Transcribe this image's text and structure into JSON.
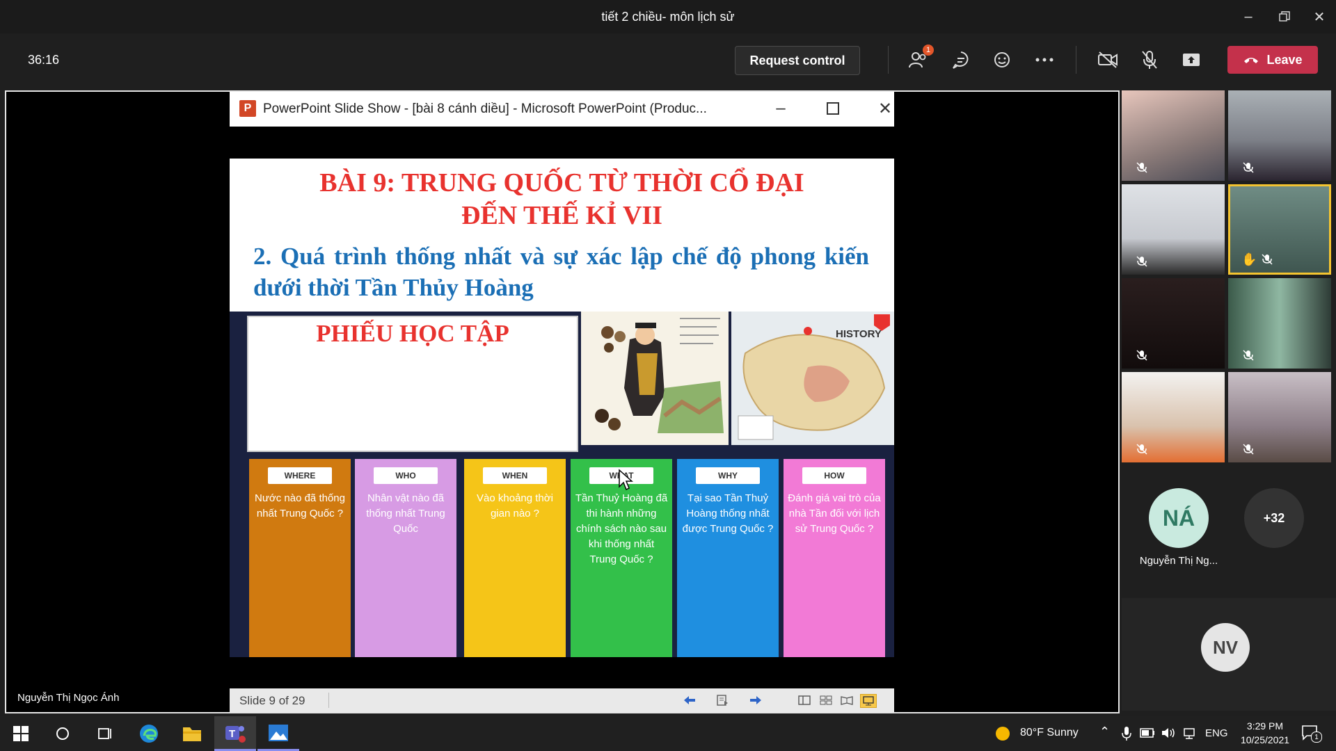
{
  "window": {
    "title": "tiết 2 chiều- môn lịch sử"
  },
  "meeting": {
    "timer": "36:16",
    "request_control": "Request control",
    "participants_badge": "1",
    "leave": "Leave"
  },
  "stage": {
    "presenter_name": "Nguyễn Thị Ngọc Ánh",
    "pp_title": "PowerPoint Slide Show - [bài 8 cánh diều] - Microsoft PowerPoint (Produc...",
    "pp_logo": "P",
    "slide": {
      "title_line1": "BÀI 9: TRUNG QUỐC TỪ THỜI CỔ ĐẠI",
      "title_line2": "ĐẾN THẾ KỈ VII",
      "subtitle": "2. Quá trình thống nhất và sự xác lập chế độ phong kiến dưới thời Tần Thủy Hoàng",
      "worksheet_title": "PHIẾU HỌC TẬP",
      "history_label": "HISTORY",
      "cards": [
        {
          "label": "WHERE",
          "text": "Nước nào đã thống nhất Trung Quốc ?",
          "color": "#d07a10"
        },
        {
          "label": "WHO",
          "text": "Nhân vật nào đã thống nhất Trung Quốc",
          "color": "#d79be4"
        },
        {
          "label": "WHEN",
          "text": "Vào khoảng thời gian nào ?",
          "color": "#f5c518"
        },
        {
          "label": "WHAT",
          "text": "Tần Thuỷ Hoàng đã thi hành những chính sách nào sau khi thống nhất Trung Quốc ?",
          "color": "#33c04a"
        },
        {
          "label": "WHY",
          "text": "Tại sao Tần Thuỷ Hoàng thống nhất được Trung Quốc ?",
          "color": "#1f8fe0"
        },
        {
          "label": "HOW",
          "text": "Đánh giá vai trò của nhà Tần đối với lịch sử Trung Quốc ?",
          "color": "#f27ad6"
        }
      ]
    },
    "status": {
      "slide_count": "Slide 9 of 29"
    }
  },
  "gallery": {
    "participant_name": "Nguyễn Thị Ng...",
    "participant_initials": "NÁ",
    "overflow_count": "+32",
    "bottom_initials": "NV"
  },
  "taskbar": {
    "weather": "80°F  Sunny",
    "language": "ENG",
    "time": "3:29 PM",
    "date": "10/25/2021",
    "notification_count": "1"
  }
}
